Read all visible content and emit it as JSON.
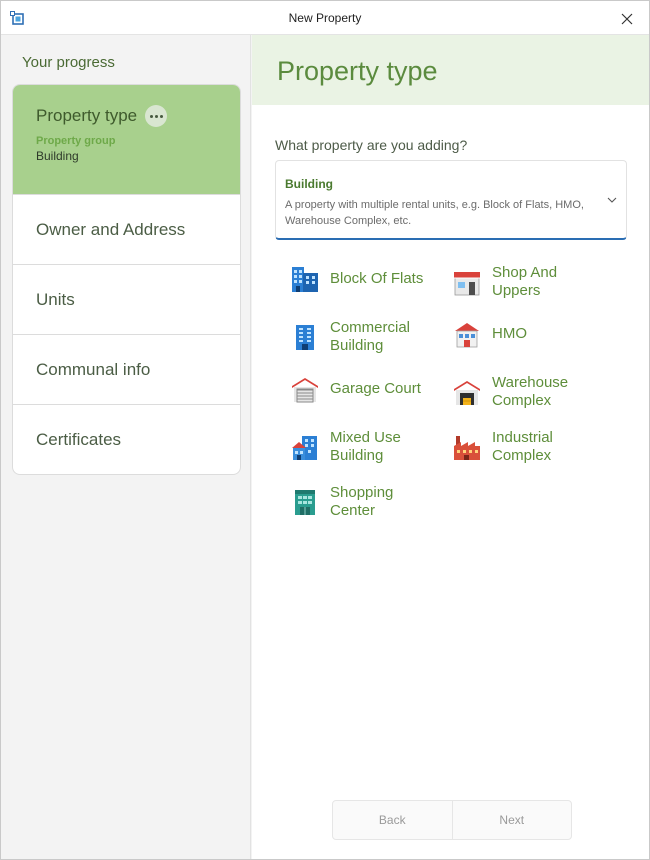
{
  "window": {
    "title": "New Property"
  },
  "sidebar": {
    "heading": "Your progress",
    "steps": [
      {
        "label": "Property type",
        "active": true,
        "sub_label": "Property group",
        "sub_value": "Building"
      },
      {
        "label": "Owner and Address"
      },
      {
        "label": "Units"
      },
      {
        "label": "Communal info"
      },
      {
        "label": "Certificates"
      }
    ]
  },
  "main": {
    "title": "Property type",
    "question": "What property are you adding?",
    "dropdown": {
      "selected_title": "Building",
      "description": "A property with multiple rental units, e.g. Block of Flats, HMO, Warehouse Complex, etc."
    },
    "options": [
      {
        "label": "Block Of Flats",
        "icon": "block-of-flats-icon"
      },
      {
        "label": "Shop And Uppers",
        "icon": "shop-icon"
      },
      {
        "label": "Commercial Building",
        "icon": "commercial-building-icon"
      },
      {
        "label": "HMO",
        "icon": "hmo-icon"
      },
      {
        "label": "Garage Court",
        "icon": "garage-icon"
      },
      {
        "label": "Warehouse Complex",
        "icon": "warehouse-icon"
      },
      {
        "label": "Mixed Use Building",
        "icon": "mixed-use-building-icon"
      },
      {
        "label": "Industrial Complex",
        "icon": "factory-icon"
      },
      {
        "label": "Shopping Center",
        "icon": "shopping-center-icon"
      }
    ]
  },
  "footer": {
    "back_label": "Back",
    "next_label": "Next"
  },
  "colors": {
    "accent_green": "#5b8b3e",
    "active_step": "#a8d08d",
    "header_band": "#eaf3e4",
    "dropdown_underline": "#2a6db3"
  }
}
